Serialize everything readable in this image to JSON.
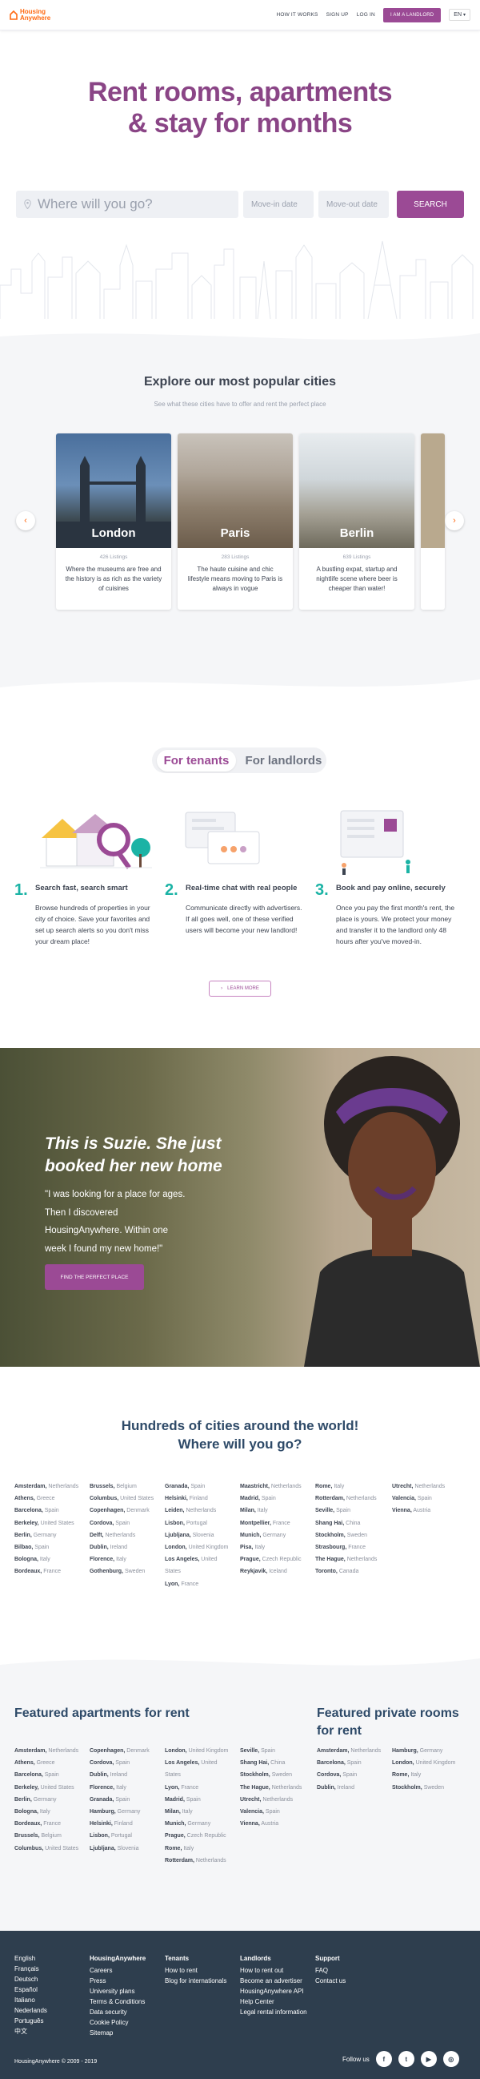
{
  "header": {
    "logo_line1": "Housing",
    "logo_line2": "Anywhere",
    "nav": [
      "HOW IT WORKS",
      "SIGN UP",
      "LOG IN"
    ],
    "landlord_button": "I AM A LANDLORD",
    "language": "EN",
    "colors": {
      "brand": "#ff6a13",
      "accent": "#9b4a95"
    }
  },
  "hero": {
    "title_line1": "Rent rooms, apartments",
    "title_line2": "& stay for months",
    "search_placeholder": "Where will you go?",
    "move_in": "Move-in date",
    "move_out": "Move-out date",
    "search_button": "SEARCH"
  },
  "popular": {
    "title": "Explore our most popular cities",
    "subtitle": "See what these cities have to offer and rent the perfect place",
    "cities": [
      {
        "name": "London",
        "listings": "426 Listings",
        "desc": "Where the museums are free and the history is as rich as the variety of cuisines"
      },
      {
        "name": "Paris",
        "listings": "283 Listings",
        "desc": "The haute cuisine and chic lifestyle means moving to Paris is always in vogue"
      },
      {
        "name": "Berlin",
        "listings": "639 Listings",
        "desc": "A bustling expat, startup and nightlife scene where beer is cheaper than water!"
      }
    ]
  },
  "how": {
    "tab_tenants": "For tenants",
    "tab_landlords": "For landlords",
    "steps": [
      {
        "num": "1.",
        "title": "Search fast, search smart",
        "text": "Browse hundreds of properties in your city of choice. Save your favorites and set up search alerts so you don't miss your dream place!"
      },
      {
        "num": "2.",
        "title": "Real-time chat with real people",
        "text": "Communicate directly with advertisers. If all goes well, one of these verified users will become your new landlord!"
      },
      {
        "num": "3.",
        "title": "Book and pay online, securely",
        "text": "Once you pay the first month's rent, the place is yours. We protect your money and transfer it to the landlord only 48 hours after you've moved-in."
      }
    ],
    "learn_more": "LEARN MORE"
  },
  "testimonial": {
    "title": "This is Suzie. She just booked her new home",
    "quote": "\"I was looking for a place for ages. Then I discovered HousingAnywhere. Within one week I found my new home!\"",
    "cta": "FIND THE PERFECT PLACE"
  },
  "hundreds": {
    "title_line1": "Hundreds of cities around the world!",
    "title_line2": "Where will you go?",
    "columns": [
      [
        [
          "Amsterdam,",
          "Netherlands"
        ],
        [
          "Athens,",
          "Greece"
        ],
        [
          "Barcelona,",
          "Spain"
        ],
        [
          "Berkeley,",
          "United States"
        ],
        [
          "Berlin,",
          "Germany"
        ],
        [
          "Bilbao,",
          "Spain"
        ],
        [
          "Bologna,",
          "Italy"
        ],
        [
          "Bordeaux,",
          "France"
        ]
      ],
      [
        [
          "Brussels,",
          "Belgium"
        ],
        [
          "Columbus,",
          "United States"
        ],
        [
          "Copenhagen,",
          "Denmark"
        ],
        [
          "Cordova,",
          "Spain"
        ],
        [
          "Delft,",
          "Netherlands"
        ],
        [
          "Dublin,",
          "Ireland"
        ],
        [
          "Florence,",
          "Italy"
        ],
        [
          "Gothenburg,",
          "Sweden"
        ]
      ],
      [
        [
          "Granada,",
          "Spain"
        ],
        [
          "Helsinki,",
          "Finland"
        ],
        [
          "Leiden,",
          "Netherlands"
        ],
        [
          "Lisbon,",
          "Portugal"
        ],
        [
          "Ljubljana,",
          "Slovenia"
        ],
        [
          "London,",
          "United Kingdom"
        ],
        [
          "Los Angeles,",
          "United"
        ],
        [
          "",
          "States"
        ],
        [
          "Lyon,",
          "France"
        ]
      ],
      [
        [
          "Maastricht,",
          "Netherlands"
        ],
        [
          "Madrid,",
          "Spain"
        ],
        [
          "Milan,",
          "Italy"
        ],
        [
          "Montpellier,",
          "France"
        ],
        [
          "Munich,",
          "Germany"
        ],
        [
          "Pisa,",
          "Italy"
        ],
        [
          "Prague,",
          "Czech Republic"
        ],
        [
          "Reykjavik,",
          "Iceland"
        ]
      ],
      [
        [
          "Rome,",
          "Italy"
        ],
        [
          "Rotterdam,",
          "Netherlands"
        ],
        [
          "Seville,",
          "Spain"
        ],
        [
          "Shang Hai,",
          "China"
        ],
        [
          "Stockholm,",
          "Sweden"
        ],
        [
          "Strasbourg,",
          "France"
        ],
        [
          "The Hague,",
          "Netherlands"
        ],
        [
          "Toronto,",
          "Canada"
        ]
      ],
      [
        [
          "Utrecht,",
          "Netherlands"
        ],
        [
          "Valencia,",
          "Spain"
        ],
        [
          "Vienna,",
          "Austria"
        ]
      ]
    ]
  },
  "featured": {
    "apartments_title": "Featured apartments for rent",
    "private_title_line1": "Featured private rooms",
    "private_title_line2": "for rent",
    "apartment_columns": [
      [
        [
          "Amsterdam,",
          "Netherlands"
        ],
        [
          "Athens,",
          "Greece"
        ],
        [
          "Barcelona,",
          "Spain"
        ],
        [
          "Berkeley,",
          "United States"
        ],
        [
          "Berlin,",
          "Germany"
        ],
        [
          "Bologna,",
          "Italy"
        ],
        [
          "Bordeaux,",
          "France"
        ],
        [
          "Brussels,",
          "Belgium"
        ],
        [
          "Columbus,",
          "United States"
        ]
      ],
      [
        [
          "Copenhagen,",
          "Denmark"
        ],
        [
          "Cordova,",
          "Spain"
        ],
        [
          "Dublin,",
          "Ireland"
        ],
        [
          "Florence,",
          "Italy"
        ],
        [
          "Granada,",
          "Spain"
        ],
        [
          "Hamburg,",
          "Germany"
        ],
        [
          "Helsinki,",
          "Finland"
        ],
        [
          "Lisbon,",
          "Portugal"
        ],
        [
          "Ljubljana,",
          "Slovenia"
        ]
      ],
      [
        [
          "London,",
          "United Kingdom"
        ],
        [
          "Los Angeles,",
          "United"
        ],
        [
          "",
          "States"
        ],
        [
          "Lyon,",
          "France"
        ],
        [
          "Madrid,",
          "Spain"
        ],
        [
          "Milan,",
          "Italy"
        ],
        [
          "Munich,",
          "Germany"
        ],
        [
          "Prague,",
          "Czech Republic"
        ],
        [
          "Rome,",
          "Italy"
        ],
        [
          "Rotterdam,",
          "Netherlands"
        ]
      ],
      [
        [
          "Seville,",
          "Spain"
        ],
        [
          "Shang Hai,",
          "China"
        ],
        [
          "Stockholm,",
          "Sweden"
        ],
        [
          "The Hague,",
          "Netherlands"
        ],
        [
          "Utrecht,",
          "Netherlands"
        ],
        [
          "Valencia,",
          "Spain"
        ],
        [
          "Vienna,",
          "Austria"
        ]
      ]
    ],
    "private_columns": [
      [
        [
          "Amsterdam,",
          "Netherlands"
        ],
        [
          "Barcelona,",
          "Spain"
        ],
        [
          "Cordova,",
          "Spain"
        ],
        [
          "Dublin,",
          "Ireland"
        ]
      ],
      [
        [
          "Hamburg,",
          "Germany"
        ],
        [
          "London,",
          "United Kingdom"
        ],
        [
          "Rome,",
          "Italy"
        ],
        [
          "Stockholm,",
          "Sweden"
        ]
      ]
    ]
  },
  "footer": {
    "languages": [
      "English",
      "Français",
      "Deutsch",
      "Español",
      "Italiano",
      "Nederlands",
      "Português",
      "中文"
    ],
    "housing_title": "HousingAnywhere",
    "housing_links": [
      "Careers",
      "Press",
      "University plans",
      "Terms & Conditions",
      "Data security",
      "Cookie Policy",
      "Sitemap"
    ],
    "tenants_title": "Tenants",
    "tenants_links": [
      "How to rent",
      "Blog for internationals"
    ],
    "landlords_title": "Landlords",
    "landlords_links": [
      "How to rent out",
      "Become an advertiser",
      "HousingAnywhere API",
      "Help Center",
      "Legal rental information"
    ],
    "support_title": "Support",
    "support_links": [
      "FAQ",
      "Contact us"
    ],
    "copyright": "HousingAnywhere © 2009 - 2019",
    "follow": "Follow us",
    "social_icons": [
      "facebook-icon",
      "twitter-icon",
      "youtube-icon",
      "instagram-icon"
    ]
  }
}
